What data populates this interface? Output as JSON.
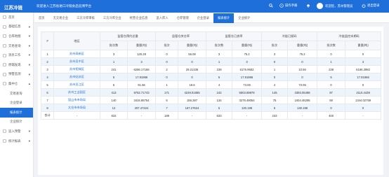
{
  "app": {
    "logo": "江苏冷链",
    "system_title": "欢迎进入江苏省进口冷链食品追溯平台"
  },
  "topbar": {
    "manual": "操作手册",
    "user": "欢迎您，苏州管理员",
    "logout": "退出登录"
  },
  "sidebar": {
    "items": [
      {
        "label": "首页",
        "icon": "home-icon"
      },
      {
        "label": "基础信息",
        "icon": "info-icon",
        "arrow": "▾"
      },
      {
        "label": "仓库地图",
        "icon": "map-icon",
        "arrow": "▾"
      },
      {
        "label": "交易查询",
        "icon": "exchange-icon",
        "arrow": "▾"
      },
      {
        "label": "消杀工作",
        "icon": "task-icon",
        "arrow": "▾"
      },
      {
        "label": "原辅发现",
        "icon": "search-icon",
        "arrow": "▾"
      },
      {
        "label": "预警监测",
        "icon": "alert-icon",
        "arrow": "▾"
      },
      {
        "label": "集中仓",
        "icon": "warehouse-icon",
        "arrow": "▴"
      },
      {
        "label": "交易查询",
        "sub": true
      },
      {
        "label": "企业登录",
        "sub": true
      },
      {
        "label": "报表统计",
        "sub": true,
        "active": true
      },
      {
        "label": "企业统计",
        "sub": true
      },
      {
        "label": "追入预警",
        "icon": "warning-icon",
        "arrow": "▾"
      },
      {
        "label": "统计报表",
        "icon": "chart-icon",
        "arrow": "▾"
      }
    ]
  },
  "tabs": [
    {
      "label": "首页"
    },
    {
      "label": "无交易企业"
    },
    {
      "label": "三方冷库审核"
    },
    {
      "label": "三方冷库企业"
    },
    {
      "label": "经营企业信息"
    },
    {
      "label": "追入库入"
    },
    {
      "label": "仓库管理"
    },
    {
      "label": "企业登录"
    },
    {
      "label": "报表统计",
      "active": true
    },
    {
      "label": "企业统计"
    }
  ],
  "table": {
    "h1": {
      "no": "#",
      "area": "地区",
      "g1": "监管仓预约总量",
      "g2": "监管仓关仓率",
      "g3": "监管仓已放率",
      "g4": "冷链已赋码",
      "g5": "冷链监控末期码"
    },
    "h2": {
      "batch": "批次数",
      "weight": "重量(吨)",
      "batch2": "批次",
      "rate": "重量(吨)"
    },
    "rows": [
      [
        "1",
        "苏州高新区",
        "3",
        "125.28",
        "0",
        "56.08",
        "3",
        "75.2",
        "3",
        "75.2",
        "0",
        "0"
      ],
      [
        "2",
        "苏州吴中区",
        "1",
        "3",
        "0",
        "0",
        "1",
        "3",
        "0",
        "0",
        "1",
        "3"
      ],
      [
        "3",
        "苏州相城区",
        "241",
        "6266.17156",
        "2",
        "29.21336",
        "239",
        "6176.9582",
        "1",
        "10.56",
        "238",
        "6166.3982"
      ],
      [
        "4",
        "苏州姑苏区",
        "5",
        "17.91966",
        "0",
        "0",
        "5",
        "17.91966",
        "0",
        "0",
        "5",
        "17.91966"
      ],
      [
        "5",
        "苏州吴江区",
        "5",
        "91.56",
        "1",
        "18.6",
        "4",
        "73.06",
        "4",
        "73.06",
        "0",
        "0"
      ],
      [
        "6",
        "苏州工业园区",
        "413",
        "9752.71743",
        "171",
        "4249.01865",
        "242",
        "5503.69878",
        "145",
        "3393.05488",
        "97",
        "2110.4439"
      ],
      [
        "7",
        "昆山市市场局",
        "140",
        "3434.86754",
        "6",
        "156.397",
        "134",
        "3278.49054",
        "75",
        "1934.46295",
        "59",
        "1344.02759"
      ],
      [
        "8",
        "太仓市市场局",
        "12",
        "297.47424",
        "7",
        "167.27624",
        "5",
        "130.198",
        "5",
        "130.198",
        "0",
        "0"
      ],
      [
        "合计",
        "-",
        "822",
        "-",
        "189",
        "-",
        "633",
        "-",
        "233",
        "-",
        "400",
        "-"
      ]
    ]
  }
}
